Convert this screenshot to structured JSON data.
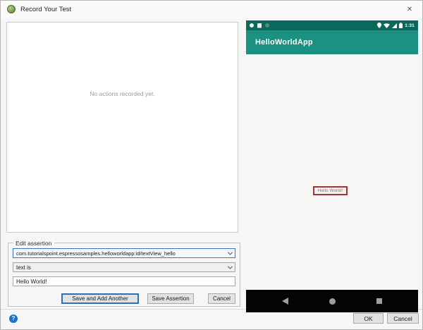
{
  "window": {
    "title": "Record Your Test"
  },
  "icons": {
    "close": "✕",
    "help": "?"
  },
  "actions_panel": {
    "empty_message": "No actions recorded yet."
  },
  "assertion_panel": {
    "group_label": "Edit assertion",
    "element_selector": "com.tutorialspoint.espressosamples.helloworldapp:id/textView_hello",
    "assertion_type": "text is",
    "expected_text": "Hello World!",
    "save_add_button": "Save and Add Another",
    "save_button": "Save Assertion",
    "cancel_button": "Cancel"
  },
  "emulator": {
    "status_time": "1:31",
    "app_title": "HelloWorldApp",
    "hello_label": "Hello World!"
  },
  "footer": {
    "ok_button": "OK",
    "cancel_button": "Cancel"
  },
  "colors": {
    "status_bar": "#0a695b",
    "app_bar": "#1b9281",
    "screen_bg": "#f7f6f5",
    "nav_bar": "#040404",
    "highlight_border": "#9e3535",
    "focus_blue": "#2f6fb5",
    "help_blue": "#1a73c9",
    "dialog_bg": "#f6f6f6"
  }
}
